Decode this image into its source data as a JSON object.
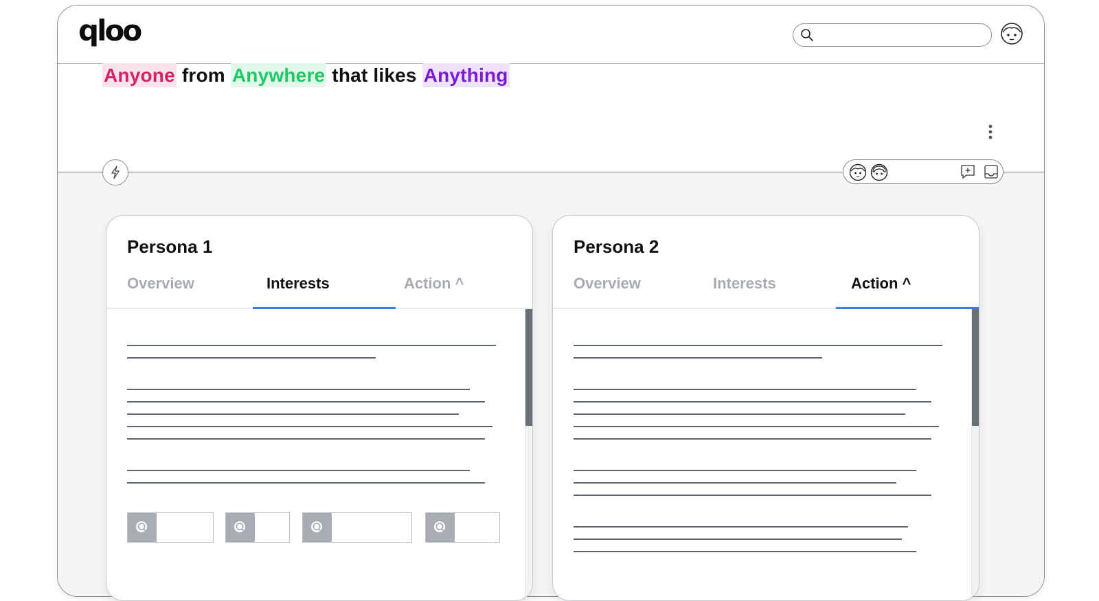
{
  "header": {
    "logo_text": "qloo",
    "search_placeholder": "",
    "icons": {
      "search": "search-icon",
      "profile": "face-icon"
    }
  },
  "hero": {
    "headline": {
      "who": "Anyone",
      "from": "from",
      "where": "Anywhere",
      "that_likes": "that likes",
      "what": "Anything"
    },
    "colors": {
      "who": "#d6216b",
      "where": "#1fc964",
      "what": "#7a1cd6"
    },
    "icons": [
      "more-vertical-icon",
      "lightning-icon",
      "face-icon",
      "face-icon",
      "add-comment-icon",
      "inbox-icon"
    ]
  },
  "cards": [
    {
      "title": "Persona 1",
      "tabs": [
        {
          "label": "Overview",
          "active": false
        },
        {
          "label": "Interests",
          "active": true
        },
        {
          "label": "Action ^",
          "active": false
        }
      ],
      "chip_icon": "search-icon"
    },
    {
      "title": "Persona 2",
      "tabs": [
        {
          "label": "Overview",
          "active": false
        },
        {
          "label": "Interests",
          "active": false
        },
        {
          "label": "Action ^",
          "active": true
        }
      ]
    }
  ],
  "accent_color": "#3b7bea"
}
